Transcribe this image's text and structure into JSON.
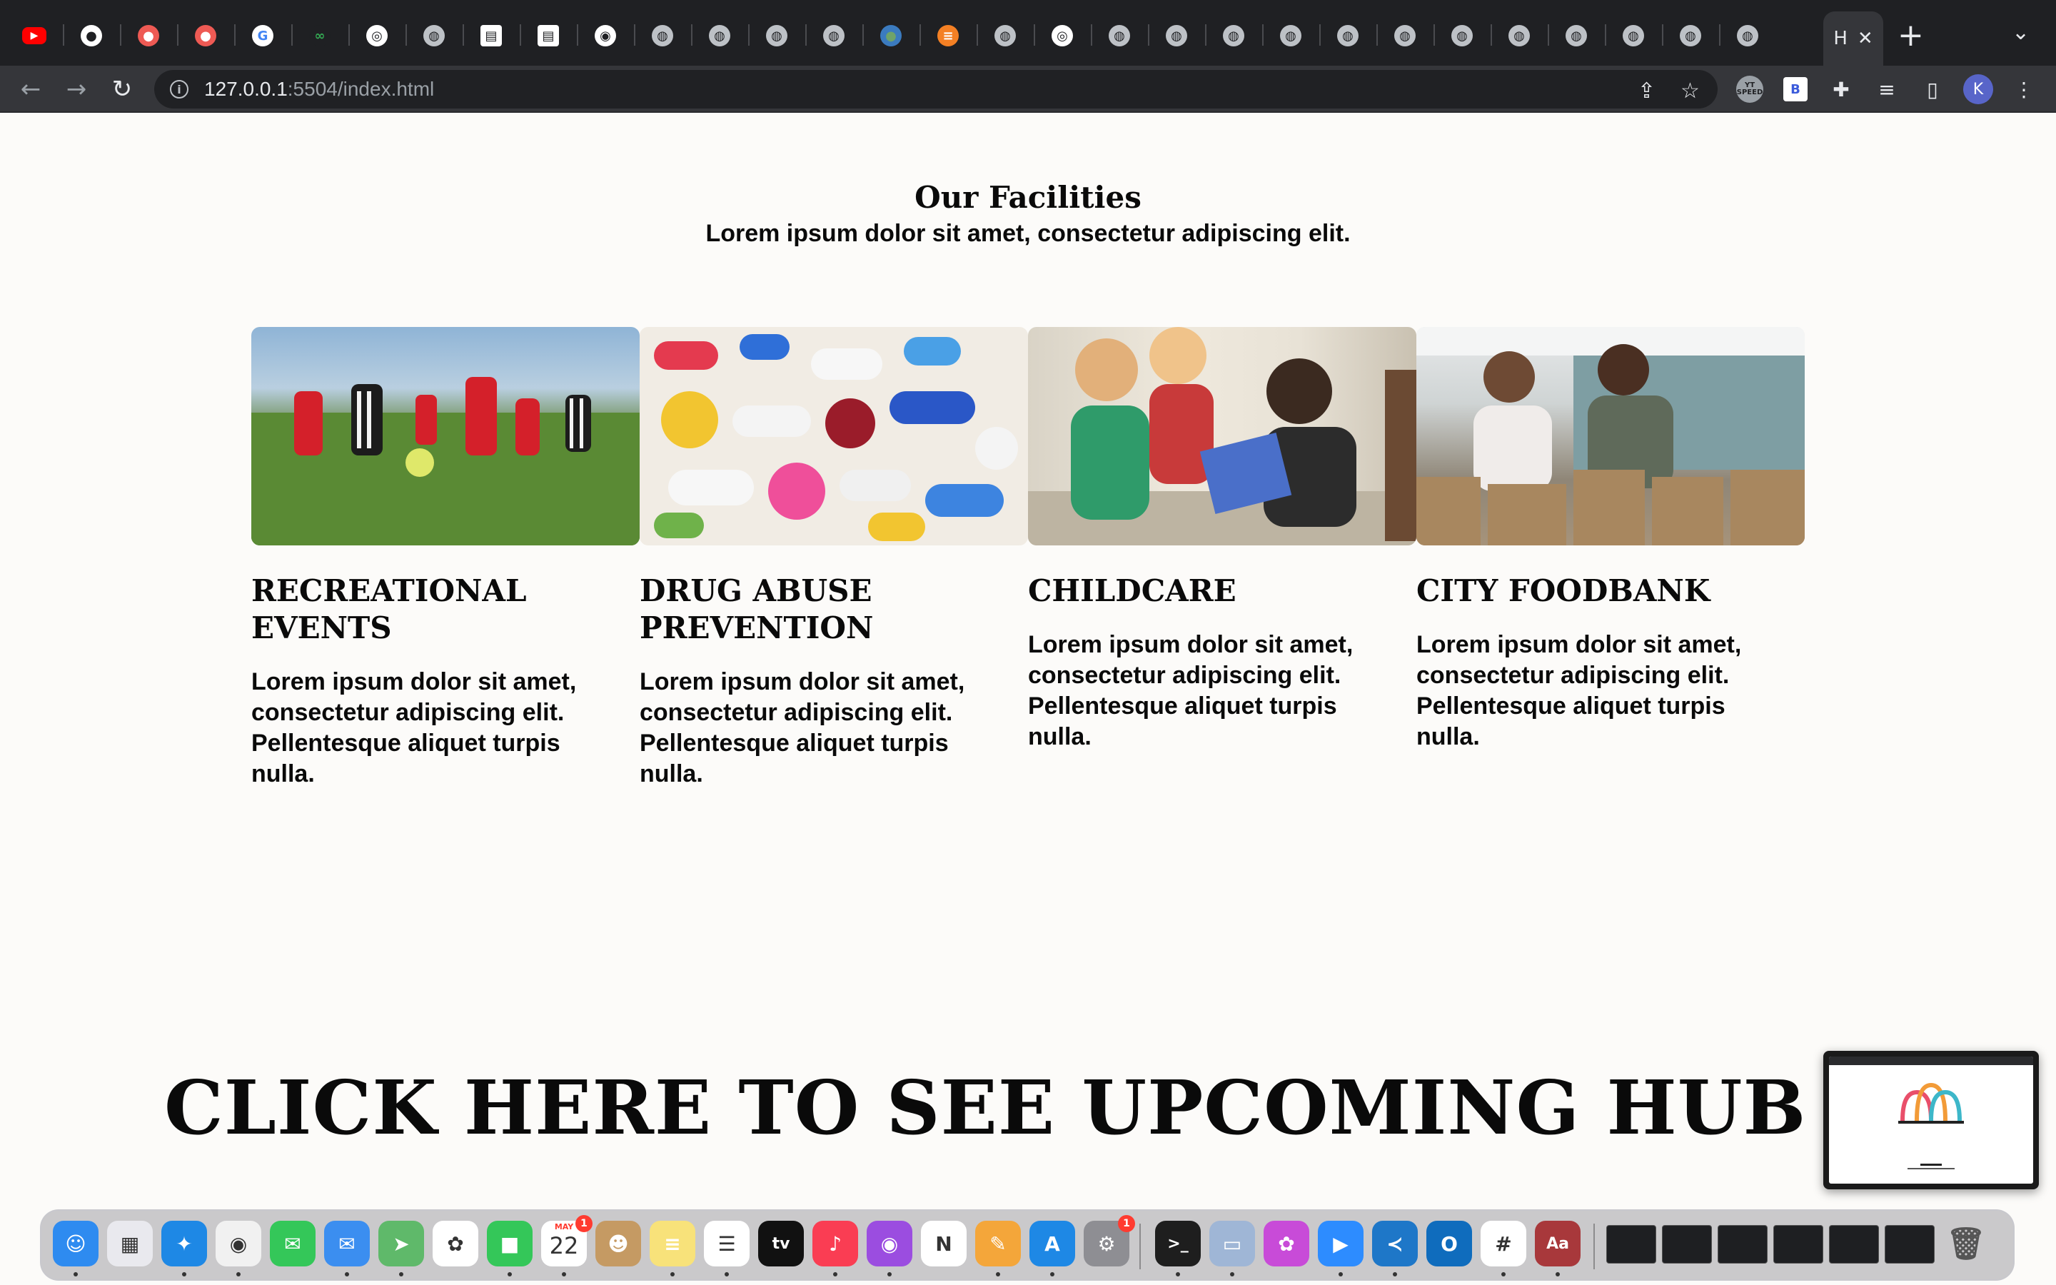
{
  "browser": {
    "active_tab_label": "H",
    "close_glyph": "✕",
    "new_tab_glyph": "+",
    "tab_menu_glyph": "⌄",
    "url_host": "127.0.0.1",
    "url_path": ":5504/index.html",
    "profile_initial": "K",
    "ext_b_label": "B",
    "ext_speed_label": "YT SPEED",
    "tab_favicons": [
      "youtube-icon",
      "github-icon",
      "procreate-icon",
      "procreate-icon",
      "google-icon",
      "infinity-icon",
      "openai-icon",
      "globe-icon",
      "folder-icon",
      "folder-icon",
      "chrome-icon",
      "globe-icon",
      "globe-icon",
      "globe-icon",
      "globe-icon",
      "earth-icon",
      "stackoverflow-icon",
      "globe-icon",
      "openai-icon",
      "globe-icon",
      "globe-icon",
      "globe-icon",
      "globe-icon",
      "globe-icon",
      "globe-icon",
      "globe-icon",
      "globe-icon",
      "globe-icon",
      "globe-icon",
      "globe-icon",
      "globe-icon"
    ]
  },
  "page": {
    "section_title": "Our Facilities",
    "section_subtitle": "Lorem ipsum dolor sit amet, consectetur adipiscing elit.",
    "cards": [
      {
        "title": "RECREATIONAL EVENTS",
        "body": "Lorem ipsum dolor sit amet, consectetur adipiscing elit. Pellentesque aliquet turpis nulla.",
        "image": "soccer-players-photo"
      },
      {
        "title": "DRUG ABUSE PREVENTION",
        "body": "Lorem ipsum dolor sit amet, consectetur adipiscing elit. Pellentesque aliquet turpis nulla.",
        "image": "pills-photo"
      },
      {
        "title": "CHILDCARE",
        "body": "Lorem ipsum dolor sit amet, consectetur adipiscing elit. Pellentesque aliquet turpis nulla.",
        "image": "kids-reading-photo"
      },
      {
        "title": "CITY FOODBANK",
        "body": "Lorem ipsum dolor sit amet, consectetur adipiscing elit. Pellentesque aliquet turpis nulla.",
        "image": "foodbank-volunteers-photo"
      }
    ],
    "cta": "CLICK HERE TO SEE UPCOMING HUB EVENTS"
  },
  "dock": {
    "calendar_month": "MAY",
    "calendar_day": "22",
    "calendar_badge": "1",
    "settings_badge": "1",
    "apps": [
      "finder",
      "launchpad",
      "safari",
      "chrome",
      "messages",
      "mail",
      "maps",
      "photos",
      "facetime",
      "calendar",
      "contacts",
      "notes",
      "reminders",
      "apple-tv",
      "music",
      "podcasts",
      "news",
      "pages",
      "app-store",
      "system-preferences",
      "terminal",
      "preview",
      "flower-app",
      "zoom",
      "vscode",
      "outlook",
      "slack",
      "dictionary"
    ]
  }
}
